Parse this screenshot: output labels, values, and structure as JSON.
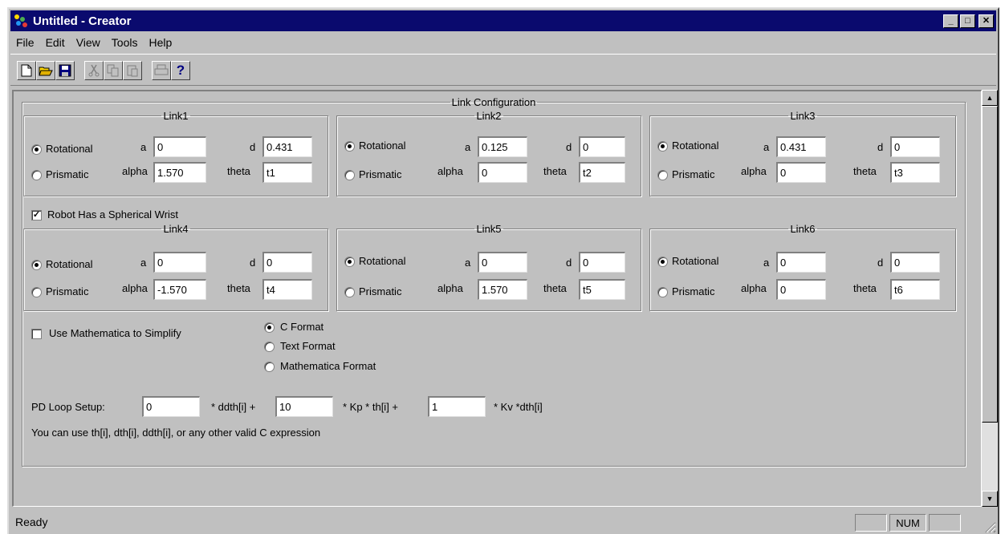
{
  "window": {
    "title": "Untitled - Creator"
  },
  "titlebar_buttons": {
    "minimize": "_",
    "maximize": "□",
    "close": "✕"
  },
  "menu": [
    "File",
    "Edit",
    "View",
    "Tools",
    "Help"
  ],
  "toolbar": {
    "icons": [
      "new-icon",
      "open-icon",
      "save-icon",
      "cut-icon",
      "copy-icon",
      "paste-icon",
      "print-icon",
      "help-icon"
    ],
    "help_glyph": "?"
  },
  "link_config": {
    "title": "Link Configuration",
    "rotational_label": "Rotational",
    "prismatic_label": "Prismatic",
    "a_label": "a",
    "d_label": "d",
    "alpha_label": "alpha",
    "theta_label": "theta",
    "links": [
      {
        "name": "Link1",
        "type": "Rotational",
        "a": "0",
        "d": "0.431",
        "alpha": "1.570",
        "theta": "t1"
      },
      {
        "name": "Link2",
        "type": "Rotational",
        "a": "0.125",
        "d": "0",
        "alpha": "0",
        "theta": "t2"
      },
      {
        "name": "Link3",
        "type": "Rotational",
        "a": "0.431",
        "d": "0",
        "alpha": "0",
        "theta": "t3"
      },
      {
        "name": "Link4",
        "type": "Rotational",
        "a": "0",
        "d": "0",
        "alpha": "-1.570",
        "theta": "t4"
      },
      {
        "name": "Link5",
        "type": "Rotational",
        "a": "0",
        "d": "0",
        "alpha": "1.570",
        "theta": "t5"
      },
      {
        "name": "Link6",
        "type": "Rotational",
        "a": "0",
        "d": "0",
        "alpha": "0",
        "theta": "t6"
      }
    ]
  },
  "spherical_wrist": {
    "label": "Robot Has a Spherical Wrist",
    "checked": true
  },
  "mathematica_simplify": {
    "label": "Use Mathematica to Simplify",
    "checked": false
  },
  "output_format": {
    "options": [
      "C Format",
      "Text Format",
      "Mathematica Format"
    ],
    "selected": "C Format"
  },
  "pd_loop": {
    "label": "PD Loop Setup:",
    "val1": "0",
    "suffix1": "* ddth[i] +",
    "val2": "10",
    "suffix2": "* Kp * th[i] +",
    "val3": "1",
    "suffix3": "* Kv *dth[i]",
    "hint": "You can use th[i], dth[i], ddth[i], or any other valid C expression"
  },
  "statusbar": {
    "text": "Ready",
    "num": "NUM"
  },
  "scrollbar": {
    "up": "▲",
    "down": "▼"
  }
}
